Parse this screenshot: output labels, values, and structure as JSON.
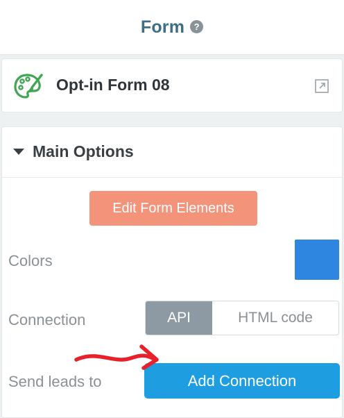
{
  "header": {
    "title": "Form",
    "help_icon": "question-circle-icon"
  },
  "form_card": {
    "name": "Opt-in Form 08",
    "icon": "palette-icon",
    "link_icon": "external-link-icon"
  },
  "options": {
    "title": "Main Options",
    "edit_button": "Edit Form Elements",
    "colors_label": "Colors",
    "color_value": "#2f86e0",
    "connection_label": "Connection",
    "connection_options": [
      "API",
      "HTML code"
    ],
    "connection_selected": "API",
    "leads_label": "Send leads to",
    "add_connection_button": "Add Connection"
  },
  "colors": {
    "accent": "#3c6e8a",
    "edit_button": "#f2937a",
    "add_button": "#1e9ee0",
    "palette_green": "#3fa652",
    "annotation_red": "#e8202a"
  }
}
